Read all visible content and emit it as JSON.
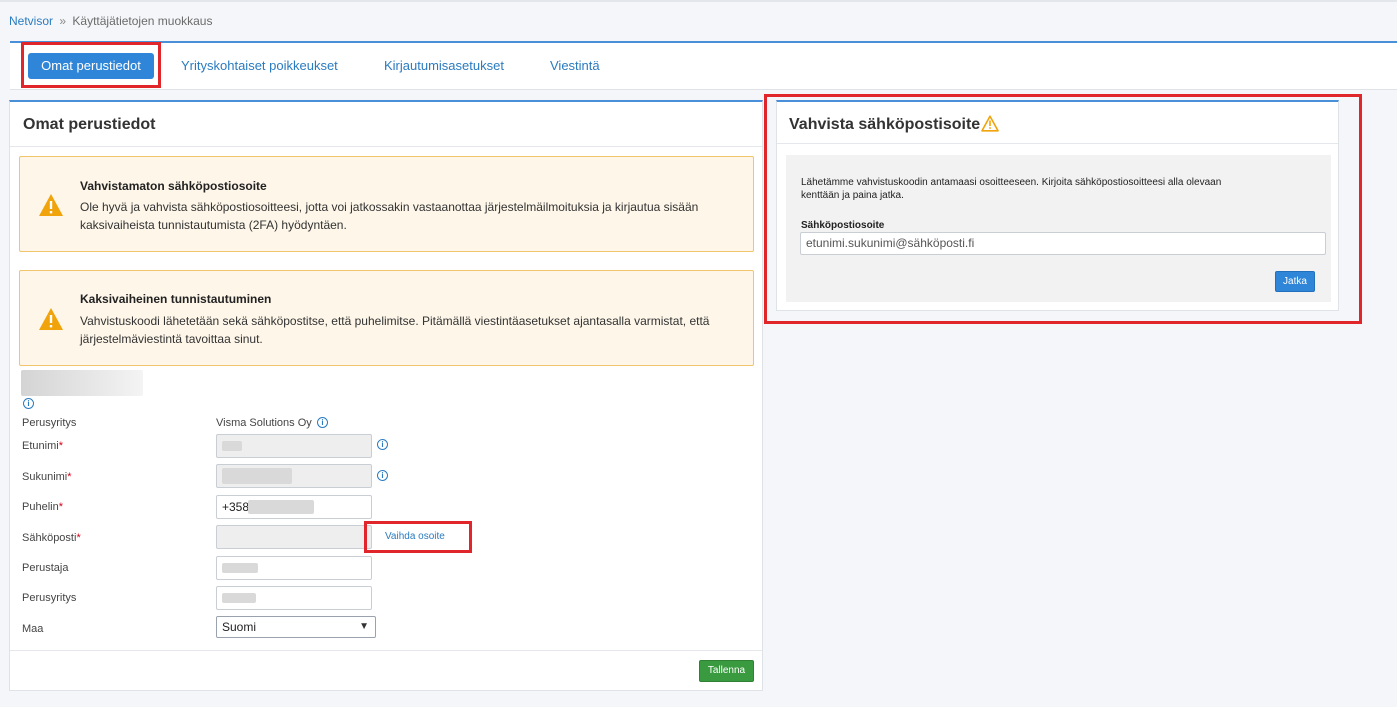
{
  "breadcrumb": {
    "root": "Netvisor",
    "separator": "»",
    "current": "Käyttäjätietojen muokkaus"
  },
  "tabs": [
    {
      "label": "Omat perustiedot",
      "active": true
    },
    {
      "label": "Yrityskohtaiset poikkeukset"
    },
    {
      "label": "Kirjautumisasetukset"
    },
    {
      "label": "Viestintä"
    }
  ],
  "main": {
    "title": "Omat perustiedot",
    "alerts": [
      {
        "title": "Vahvistamaton sähköpostiosoite",
        "text": "Ole hyvä ja vahvista sähköpostiosoitteesi, jotta voi jatkossakin vastaanottaa järjestelmäilmoituksia ja kirjautua sisään kaksivaiheista tunnistautumista (2FA) hyödyntäen."
      },
      {
        "title": "Kaksivaiheinen tunnistautuminen",
        "text": "Vahvistuskoodi lähetetään sekä sähköpostitse, että puhelimitse. Pitämällä viestintäasetukset ajantasalla varmistat, että järjestelmäviestintä tavoittaa sinut."
      }
    ],
    "form": {
      "company_label": "Perusyritys",
      "company_value": "Visma Solutions Oy",
      "first_name_label": "Etunimi",
      "last_name_label": "Sukunimi",
      "phone_label": "Puhelin",
      "phone_value": "+358",
      "email_label": "Sähköposti",
      "change_address_link": "Vaihda osoite",
      "founder_label": "Perustaja",
      "base_company_label": "Perusyritys",
      "country_label": "Maa",
      "country_value": "Suomi",
      "required_mark": "*",
      "save_label": "Tallenna"
    }
  },
  "verify": {
    "title": "Vahvista sähköpostisoite",
    "instructions": "Lähetämme vahvistuskoodin antamaasi osoitteeseen. Kirjoita sähköpostiosoitteesi alla olevaan kenttään ja paina jatka.",
    "email_label": "Sähköpostiosoite",
    "email_value": "etunimi.sukunimi@sähköposti.fi",
    "continue_label": "Jatka"
  },
  "colors": {
    "accent": "#2f85d8",
    "warning": "#f0a30a",
    "highlight": "#e0252b",
    "save": "#3a9a3f"
  }
}
